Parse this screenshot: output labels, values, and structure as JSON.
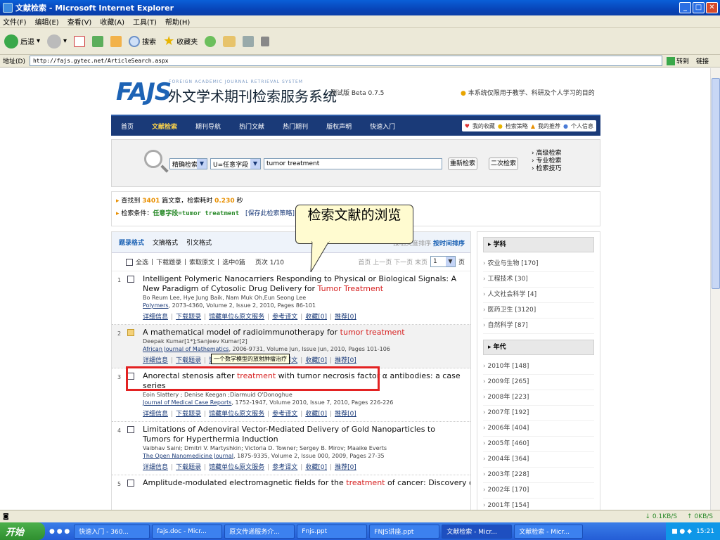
{
  "window": {
    "title": "文献检索 - Microsoft Internet Explorer"
  },
  "menu": [
    "文件(F)",
    "编辑(E)",
    "查看(V)",
    "收藏(A)",
    "工具(T)",
    "帮助(H)"
  ],
  "toolbar": {
    "back": "后退",
    "search": "搜索",
    "favorites": "收藏夹"
  },
  "address": {
    "label": "地址(D)",
    "url": "http://fajs.gytec.net/ArticleSearch.aspx",
    "go": "转到",
    "links": "链接"
  },
  "site": {
    "logo": "FAJS",
    "logo_en": "FOREIGN ACADEMIC JOURNAL RETRIEVAL SYSTEM",
    "logo_cn": "外文学术期刊检索服务系统",
    "beta": "测试版 Beta 0.7.5",
    "notice": "本系统仅限用于教学、科研及个人学习的目的"
  },
  "nav": {
    "items": [
      "首页",
      "文献检索",
      "期刊导航",
      "热门文献",
      "热门期刊",
      "版权声明",
      "快速入门"
    ],
    "right": [
      "我的收藏",
      "检索策略",
      "我的推荐",
      "个人信息"
    ]
  },
  "search": {
    "mode": "精确检索",
    "field": "U=任意字段",
    "query": "tumor treatment",
    "btn_research": "重新检索",
    "btn_second": "二次检索",
    "adv": [
      "高级检索",
      "专业检索",
      "检索技巧"
    ]
  },
  "info": {
    "found_prefix": "查找到",
    "found_count": "3401",
    "found_mid": "篇文章，检索耗时",
    "time": "0.230",
    "time_unit": "秒",
    "cond_prefix": "检索条件：",
    "cond_field": "任意字段=",
    "cond_value": "tumor treatment",
    "save": "[保存此检索策略]"
  },
  "results_head": {
    "fmt1": "题录格式",
    "fmt2": "文摘格式",
    "fmt3": "引文格式",
    "sort_a": "按相关度排序",
    "sort_b": "按时间排序"
  },
  "tools": {
    "all": "全选",
    "download": "下载题录",
    "fetch": "索取原文",
    "selected": "选中0篇",
    "page_label": "页次 1/10",
    "nav": "首页 上一页 下一页 末页",
    "page": "1",
    "page_unit": "页"
  },
  "links": [
    "详细信息",
    "下载题录",
    "馆藏单位&原文服务",
    "参考译文",
    "收藏[0]",
    "推荐[0]"
  ],
  "results": [
    {
      "n": "1",
      "title_a": "Intelligent Polymeric Nanocarriers Responding to Physical or Biological Signals: A New Paradigm of Cytosolic Drug Delivery for ",
      "hl": "Tumor Treatment",
      "title_b": "",
      "authors": "Bo Reum Lee, Hye Jung Baik, Nam Muk Oh,Eun Seong Lee",
      "journal": "Polymers",
      "pub": ", 2073-4360, Volume 2, Issue 2, 2010, Pages 86-101"
    },
    {
      "n": "2",
      "title_a": "A mathematical model of radioimmunotherapy for ",
      "hl": "tumor treatment",
      "title_b": "",
      "authors": "Deepak Kumar[1*];Sanjeev Kumar[2]",
      "journal": "African Journal of Mathematics",
      "pub": ", 2006-9731, Volume Jun, Issue Jun, 2010, Pages 101-106"
    },
    {
      "n": "3",
      "title_a": "Anorectal stenosis after ",
      "hl": "treatment",
      "title_b": " with tumor necrosis factor α antibodies: a case series",
      "authors": "Eoin Slattery ; Denise Keegan ;Diarmuid O'Donoghue",
      "journal": "Journal of Medical Case Reports",
      "pub": ", 1752-1947, Volume 2010, Issue 7, 2010, Pages 226-226"
    },
    {
      "n": "4",
      "title_a": "Limitations of Adenoviral Vector-Mediated Delivery of Gold Nanoparticles to Tumors for Hyperthermia Induction",
      "hl": "",
      "title_b": "",
      "authors": "Vaibhav Saini; Dmitri V. Martyshkin; Victoria D. Towner; Sergey B. Mirov; Maaike Everts",
      "journal": "The Open Nanomedicine Journal",
      "pub": ", 1875-9335, Volume 2, Issue 000, 2009, Pages 27-35"
    },
    {
      "n": "5",
      "title_a": "Amplitude-modulated electromagnetic fields for the ",
      "hl": "treatment",
      "title_b": " of cancer: Discovery of tumor-specific",
      "authors": "",
      "journal": "",
      "pub": ""
    }
  ],
  "sidebar": {
    "subject_head": "学科",
    "subjects": [
      "农业与生物 [170]",
      "工程技术 [30]",
      "人文社会科学 [4]",
      "医药卫生 [3120]",
      "自然科学 [87]"
    ],
    "year_head": "年代",
    "years": [
      "2010年 [148]",
      "2009年 [265]",
      "2008年 [223]",
      "2007年 [192]",
      "2006年 [404]",
      "2005年 [460]",
      "2004年 [364]",
      "2003年 [228]",
      "2002年 [170]",
      "2001年 [154]"
    ]
  },
  "annotation": {
    "callout": "检索文献的浏览",
    "tooltip": "一个数学模型的放射肿瘤治疗"
  },
  "status": {
    "down": "0.1KB/S",
    "up": "0KB/S"
  },
  "taskbar": {
    "start": "开始",
    "tasks": [
      "快速入门 - 360...",
      "fajs.doc - Micr...",
      "原文传递服务介...",
      "Fnjs.ppt",
      "FNJS讲座.ppt",
      "文献检索 - Micr...",
      "文献检索 - Micr..."
    ],
    "clock": "15:21"
  }
}
